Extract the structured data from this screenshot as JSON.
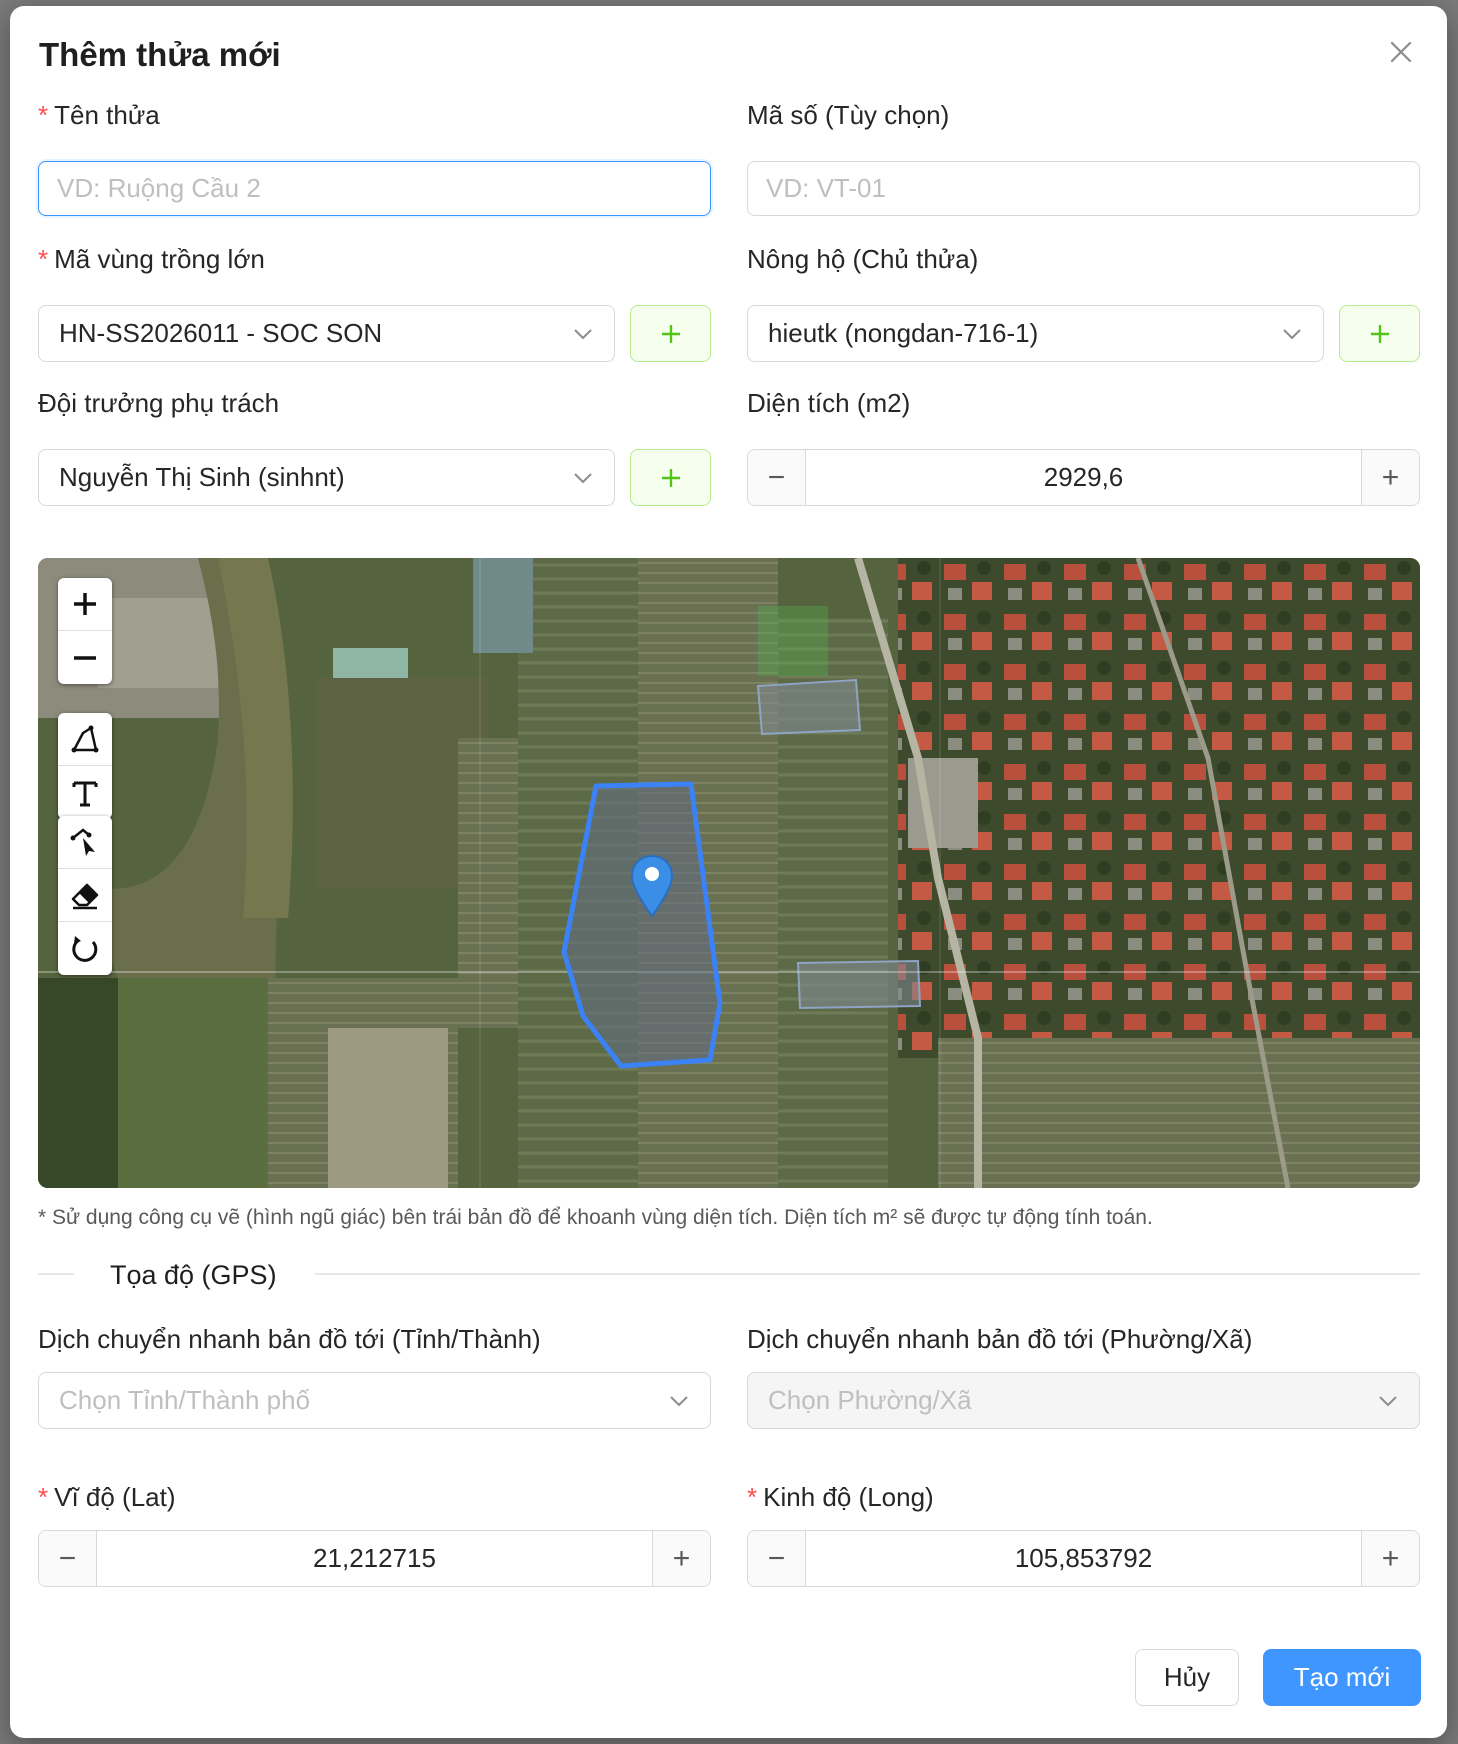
{
  "modal": {
    "title": "Thêm thửa mới",
    "fields": {
      "ten_thua": {
        "label": "Tên thửa",
        "placeholder": "VD: Ruộng Cầu 2",
        "value": ""
      },
      "ma_so": {
        "label": "Mã số (Tùy chọn)",
        "placeholder": "VD: VT-01",
        "value": ""
      },
      "ma_vung": {
        "label": "Mã vùng trồng lớn",
        "value": "HN-SS2026011 - SOC SON"
      },
      "nong_ho": {
        "label": "Nông hộ (Chủ thửa)",
        "value": "hieutk (nongdan-716-1)"
      },
      "doi_truong": {
        "label": "Đội trưởng phụ trách",
        "value": "Nguyễn Thị Sinh (sinhnt)"
      },
      "dien_tich": {
        "label": "Diện tích (m2)",
        "value": "2929,6"
      }
    },
    "required_mark": "*",
    "plus": "+",
    "minus": "−",
    "map": {
      "hint": "* Sử dụng công cụ vẽ (hình ngũ giác) bên trái bản đồ để khoanh vùng diện tích. Diện tích m² sẽ được tự động tính toán.",
      "zoom_in": "+",
      "zoom_out": "−"
    },
    "gps": {
      "section_title": "Tọa độ (GPS)",
      "tinh": {
        "label": "Dịch chuyển nhanh bản đồ tới (Tỉnh/Thành)",
        "placeholder": "Chọn Tỉnh/Thành phố"
      },
      "phuong": {
        "label": "Dịch chuyển nhanh bản đồ tới (Phường/Xã)",
        "placeholder": "Chọn Phường/Xã"
      },
      "lat": {
        "label": "Vĩ độ (Lat)",
        "value": "21,212715"
      },
      "long": {
        "label": "Kinh độ (Long)",
        "value": "105,853792"
      }
    },
    "footer": {
      "cancel": "Hủy",
      "create": "Tạo mới"
    }
  },
  "colors": {
    "primary": "#4096ff",
    "success_border": "#b7eb8f",
    "success_bg": "#f6ffed",
    "required": "#ff4d4f",
    "polygon": "#3b82f6"
  }
}
